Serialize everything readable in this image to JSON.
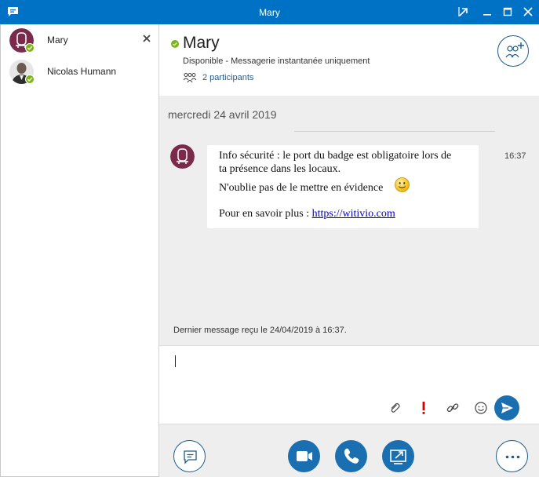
{
  "window": {
    "title": "Mary"
  },
  "sidebar": {
    "contacts": [
      {
        "name": "Mary",
        "presence": "available"
      },
      {
        "name": "Nicolas Humann",
        "presence": "available"
      }
    ]
  },
  "header": {
    "contact_name": "Mary",
    "status": "Disponible - Messagerie instantanée uniquement",
    "participants": "2 participants"
  },
  "conversation": {
    "date_separator": "mercredi 24 avril 2019",
    "message": {
      "line1": "Info sécurité : le port du badge est obligatoire lors de",
      "line2": "ta présence dans les locaux.",
      "line3": "N'oublie pas de le mettre en évidence",
      "line4_prefix": "Pour en savoir plus : ",
      "link": "https://witivio.com",
      "time": "16:37"
    },
    "last_received": "Dernier message reçu le 24/04/2019 à 16:37."
  },
  "colors": {
    "titlebar": "#0072c6",
    "accent": "#1a6fb0",
    "presence_available": "#7cb518",
    "avatar_mary": "#7a2a4a"
  }
}
